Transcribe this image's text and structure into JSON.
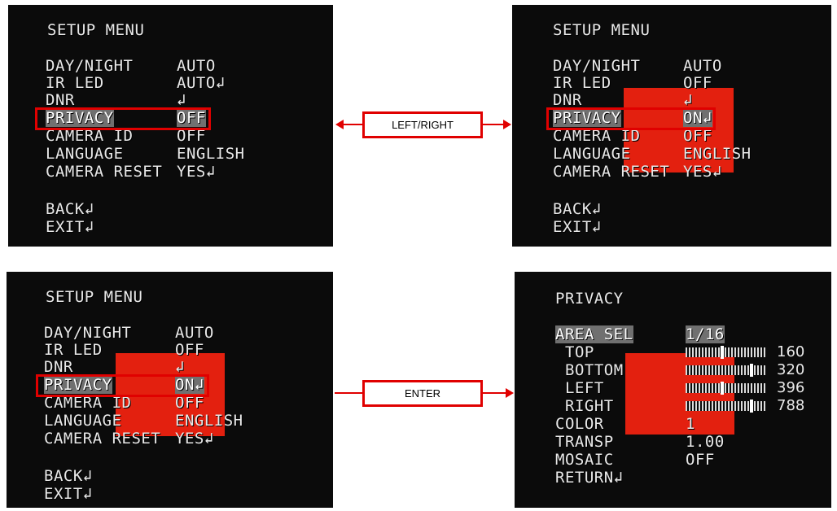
{
  "screen1": {
    "title": "SETUP MENU",
    "labels": [
      "DAY/NIGHT",
      "IR LED",
      "DNR",
      "PRIVACY",
      "CAMERA ID",
      "LANGUAGE",
      "CAMERA RESET"
    ],
    "values": [
      "AUTO",
      "AUTO↲",
      "↲",
      "OFF",
      "OFF",
      "ENGLISH",
      "YES↲"
    ],
    "back": "BACK↲",
    "exit": "EXIT↲"
  },
  "screen2": {
    "title": "SETUP MENU",
    "labels": [
      "DAY/NIGHT",
      "IR LED",
      "DNR",
      "PRIVACY",
      "CAMERA ID",
      "LANGUAGE",
      "CAMERA RESET"
    ],
    "values": [
      "AUTO",
      "OFF",
      "↲",
      "ON↲",
      "OFF",
      "ENGLISH",
      "YES↲"
    ],
    "back": "BACK↲",
    "exit": "EXIT↲"
  },
  "screen3": {
    "title": "SETUP MENU",
    "labels": [
      "DAY/NIGHT",
      "IR LED",
      "DNR",
      "PRIVACY",
      "CAMERA ID",
      "LANGUAGE",
      "CAMERA RESET"
    ],
    "values": [
      "AUTO",
      "OFF",
      "↲",
      "ON↲",
      "OFF",
      "ENGLISH",
      "YES↲"
    ],
    "back": "BACK↲",
    "exit": "EXIT↲"
  },
  "screen4": {
    "title": "PRIVACY",
    "area_sel_label": "AREA SEL",
    "area_sel_value": "1/16",
    "top_label": "TOP",
    "top_value": "160",
    "top_level": 0.45,
    "bottom_label": "BOTTOM",
    "bottom_value": "320",
    "bottom_level": 0.82,
    "left_label": "LEFT",
    "left_value": "396",
    "left_level": 0.45,
    "right_label": "RIGHT",
    "right_value": "788",
    "right_level": 0.82,
    "color_label": "COLOR",
    "color_value": "1",
    "transp_label": "TRANSP",
    "transp_value": "1.00",
    "mosaic_label": "MOSAIC",
    "mosaic_value": "OFF",
    "return_label": "RETURN↲"
  },
  "connectors": {
    "left_right": "LEFT/RIGHT",
    "enter": "ENTER"
  },
  "colors": {
    "accent_red": "#e00000",
    "privacy_mask": "#e3200f",
    "osd_background": "#0b0b0b",
    "highlight": "#707070"
  }
}
